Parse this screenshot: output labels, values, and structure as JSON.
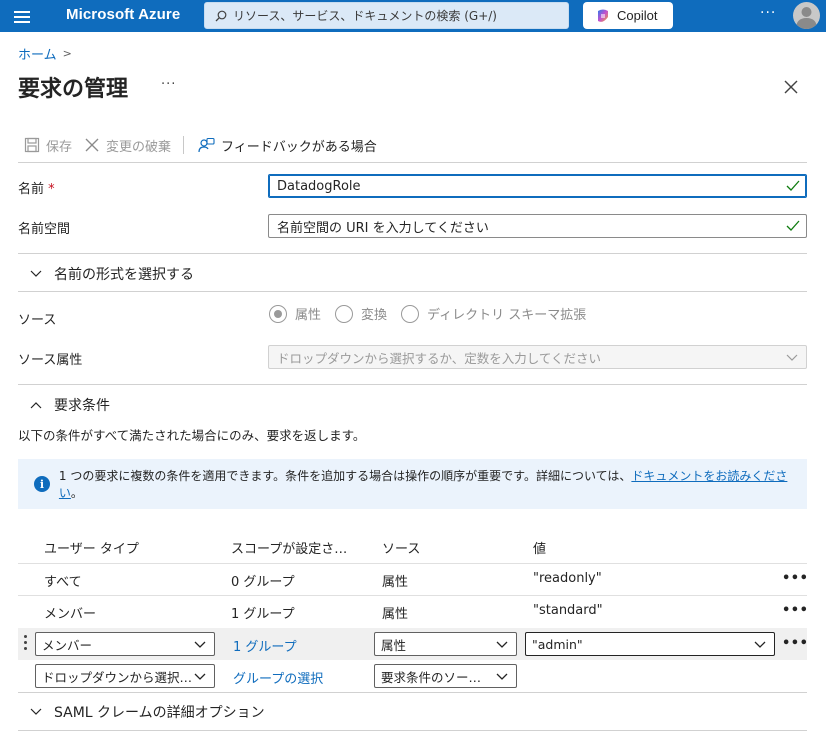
{
  "topbar": {
    "brand": "Microsoft Azure",
    "search_placeholder": "リソース、サービス、ドキュメントの検索 (G+/)",
    "copilot_label": "Copilot",
    "more": "···",
    "accent": "#0f6cbd"
  },
  "breadcrumb": {
    "home": "ホーム",
    "sep": ">"
  },
  "page": {
    "title": "要求の管理",
    "more": "···"
  },
  "toolbar": {
    "save": "保存",
    "discard": "変更の破棄",
    "feedback": "フィードバックがある場合"
  },
  "form": {
    "name_label": "名前",
    "required_mark": "*",
    "name_value": "DatadogRole",
    "namespace_label": "名前空間",
    "namespace_placeholder": "名前空間の URI を入力してください",
    "format_section": "名前の形式を選択する",
    "source_label": "ソース",
    "source_options": [
      "属性",
      "変換",
      "ディレクトリ スキーマ拡張"
    ],
    "source_selected": "属性",
    "source_attr_label": "ソース属性",
    "source_attr_placeholder": "ドロップダウンから選択するか、定数を入力してください"
  },
  "conditions": {
    "section": "要求条件",
    "description": "以下の条件がすべて満たされた場合にのみ、要求を返します。",
    "info_text": "1 つの要求に複数の条件を適用できます。条件を追加する場合は操作の順序が重要です。詳細については、",
    "info_link": "ドキュメントをお読みください",
    "info_end": "。",
    "columns": [
      "ユーザー タイプ",
      "スコープが設定さ…",
      "ソース",
      "値"
    ],
    "rows": [
      {
        "user_type": "すべて",
        "scope": "0 グループ",
        "source": "属性",
        "value": "\"readonly\""
      },
      {
        "user_type": "メンバー",
        "scope": "1 グループ",
        "source": "属性",
        "value": "\"standard\""
      }
    ],
    "edit_row": {
      "user_type": "メンバー",
      "scope": "1 グループ",
      "source": "属性",
      "value": "\"admin\""
    },
    "new_row": {
      "user_type_placeholder": "ドロップダウンから選択…",
      "scope_link": "グループの選択",
      "source_placeholder": "要求条件のソー…"
    },
    "row_more": "•••"
  },
  "saml_section": "SAML クレームの詳細オプション"
}
